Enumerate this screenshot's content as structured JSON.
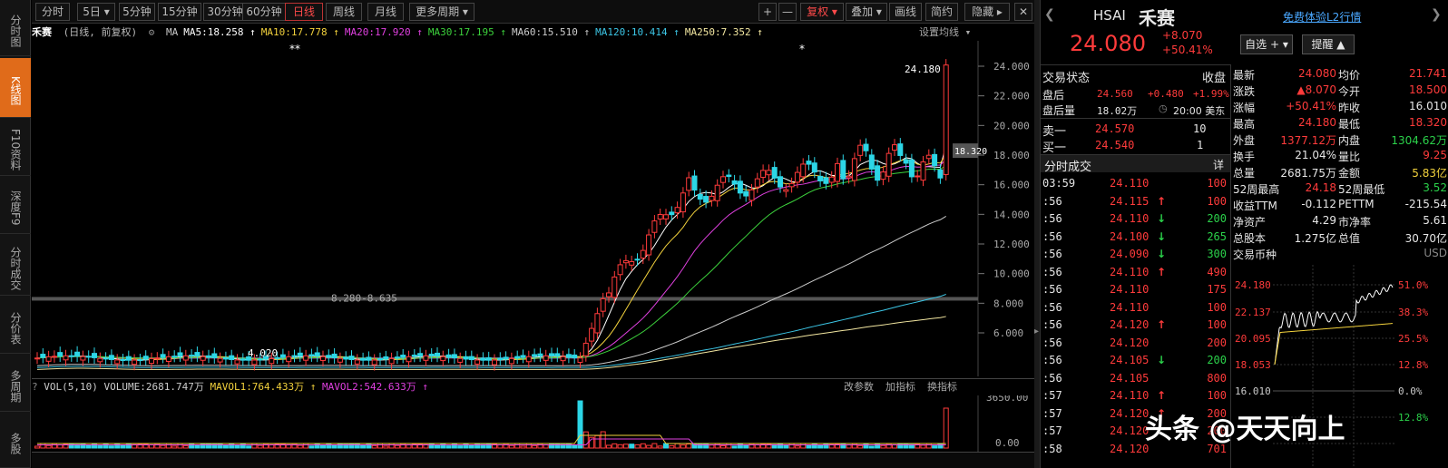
{
  "sidebar": {
    "items": [
      {
        "label": "分时图"
      },
      {
        "label": "K线图"
      },
      {
        "label": "F10资料"
      },
      {
        "label": "深度F9"
      },
      {
        "label": "分时成交"
      },
      {
        "label": "分价表"
      },
      {
        "label": "多周期"
      },
      {
        "label": "多股"
      }
    ]
  },
  "toolbar": {
    "tabs": [
      "分时",
      "5日 ▾",
      "5分钟",
      "15分钟",
      "30分钟",
      "60分钟",
      "日线",
      "周线",
      "月线",
      "更多周期 ▾"
    ],
    "active_tab": "日线",
    "right_buttons": [
      "+",
      "—",
      "复权 ▾",
      "叠加 ▾",
      "画线",
      "简约",
      "隐藏 ▸"
    ],
    "close_icon": "close-icon"
  },
  "ma_line": {
    "name": "禾赛",
    "mode": "(日线, 前复权)",
    "items": [
      {
        "label": "MA",
        "color": "#cccccc"
      },
      {
        "label": "MA5:18.258 ↑",
        "color": "#ffffff"
      },
      {
        "label": "MA10:17.778 ↑",
        "color": "#f2d13c"
      },
      {
        "label": "MA20:17.920 ↑",
        "color": "#e040e0"
      },
      {
        "label": "MA30:17.195 ↑",
        "color": "#3cd13c"
      },
      {
        "label": "MA60:15.510 ↑",
        "color": "#cccccc"
      },
      {
        "label": "MA120:10.414 ↑",
        "color": "#3cc6e6"
      },
      {
        "label": "MA250:7.352 ↑",
        "color": "#f2e6a0"
      }
    ],
    "settings": "设置均线 ▾"
  },
  "kchart": {
    "y_ticks": [
      "24.000",
      "22.000",
      "20.000",
      "18.000",
      "16.000",
      "14.000",
      "12.000",
      "10.000",
      "8.000",
      "6.000"
    ],
    "annotations": {
      "high": "24.180",
      "low": "4.020",
      "range_label": "8.280-8.635",
      "price_tag": "18.320",
      "marks": [
        "**",
        "*"
      ]
    }
  },
  "volume": {
    "header": "VOL(5,10) VOLUME:2681.747万",
    "mavol1": "MAVOL1:764.433万 ↑",
    "mavol2": "MAVOL2:542.633万 ↑",
    "links": [
      "改参数",
      "加指标",
      "换指标"
    ],
    "y_ticks": [
      "3650.00",
      "0.00"
    ]
  },
  "quote": {
    "ticker": "HSAI",
    "name": "禾赛",
    "price": "24.080",
    "change": "+8.070",
    "change_pct": "+50.41%",
    "l2_link": "免费体验L2行情",
    "watch_button": "自选 + ▾",
    "alert_button": "提醒 ▲"
  },
  "status": {
    "title": "交易状态",
    "state": "收盘",
    "after_label": "盘后",
    "after_price": "24.560",
    "after_change": "+0.480",
    "after_pct": "+1.99%",
    "after_vol_label": "盘后量",
    "after_vol": "18.02万",
    "time": "20:00 美东"
  },
  "orderbook": [
    {
      "label": "卖一",
      "price": "24.570",
      "vol": "10"
    },
    {
      "label": "买一",
      "price": "24.540",
      "vol": "1"
    }
  ],
  "ticks": {
    "title": "分时成交",
    "detail": "详",
    "rows": [
      {
        "t": "03:59",
        "p": "24.110",
        "a": "",
        "v": "100"
      },
      {
        "t": ":56",
        "p": "24.115",
        "a": "↑",
        "v": "100"
      },
      {
        "t": ":56",
        "p": "24.110",
        "a": "↓",
        "v": "200"
      },
      {
        "t": ":56",
        "p": "24.100",
        "a": "↓",
        "v": "265"
      },
      {
        "t": ":56",
        "p": "24.090",
        "a": "↓",
        "v": "300"
      },
      {
        "t": ":56",
        "p": "24.110",
        "a": "↑",
        "v": "490"
      },
      {
        "t": ":56",
        "p": "24.110",
        "a": "",
        "v": "175"
      },
      {
        "t": ":56",
        "p": "24.110",
        "a": "",
        "v": "100"
      },
      {
        "t": ":56",
        "p": "24.120",
        "a": "↑",
        "v": "100"
      },
      {
        "t": ":56",
        "p": "24.120",
        "a": "",
        "v": "200"
      },
      {
        "t": ":56",
        "p": "24.105",
        "a": "↓",
        "v": "200"
      },
      {
        "t": ":56",
        "p": "24.105",
        "a": "",
        "v": "800"
      },
      {
        "t": ":57",
        "p": "24.110",
        "a": "↑",
        "v": "100"
      },
      {
        "t": ":57",
        "p": "24.120",
        "a": "↑",
        "v": "200"
      },
      {
        "t": ":57",
        "p": "24.120",
        "a": "",
        "v": "200"
      },
      {
        "t": ":58",
        "p": "24.120",
        "a": "",
        "v": "701"
      }
    ]
  },
  "stats": [
    {
      "l1": "最新",
      "v1": "24.080",
      "c1": "up",
      "l2": "均价",
      "v2": "21.741",
      "c2": "up"
    },
    {
      "l1": "涨跌",
      "v1": "▲8.070",
      "c1": "up",
      "l2": "今开",
      "v2": "18.500",
      "c2": "up"
    },
    {
      "l1": "涨幅",
      "v1": "+50.41%",
      "c1": "up",
      "l2": "昨收",
      "v2": "16.010",
      "c2": "white"
    },
    {
      "l1": "最高",
      "v1": "24.180",
      "c1": "up",
      "l2": "最低",
      "v2": "18.320",
      "c2": "up"
    },
    {
      "l1": "外盘",
      "v1": "1377.12万",
      "c1": "up",
      "l2": "内盘",
      "v2": "1304.62万",
      "c2": "down"
    },
    {
      "l1": "换手",
      "v1": "21.04%",
      "c1": "white",
      "l2": "量比",
      "v2": "9.25",
      "c2": "up"
    },
    {
      "l1": "总量",
      "v1": "2681.75万",
      "c1": "white",
      "l2": "金额",
      "v2": "5.83亿",
      "c2": "yellow"
    },
    {
      "l1": "52周最高",
      "v1": "24.18",
      "c1": "up",
      "l2": "52周最低",
      "v2": "3.52",
      "c2": "down"
    },
    {
      "l1": "收益TTM",
      "v1": "-0.112",
      "c1": "white",
      "l2": "PETTM",
      "v2": "-215.54",
      "c2": "white"
    },
    {
      "l1": "净资产",
      "v1": "4.29",
      "c1": "white",
      "l2": "市净率",
      "v2": "5.61",
      "c2": "white"
    },
    {
      "l1": "总股本",
      "v1": "1.275亿",
      "c1": "white",
      "l2": "总值",
      "v2": "30.70亿",
      "c2": "white"
    },
    {
      "l1": "交易币种",
      "v1": "",
      "c1": "white",
      "l2": "",
      "v2": "USD",
      "c2": "gray"
    }
  ],
  "mini_chart": {
    "left_ticks": [
      "24.180",
      "22.137",
      "20.095",
      "18.053",
      "16.010"
    ],
    "right_ticks": [
      "51.0%",
      "38.3%",
      "25.5%",
      "12.8%",
      "0.0%",
      "12.8%"
    ]
  },
  "watermark": "头条 @天天向上"
}
